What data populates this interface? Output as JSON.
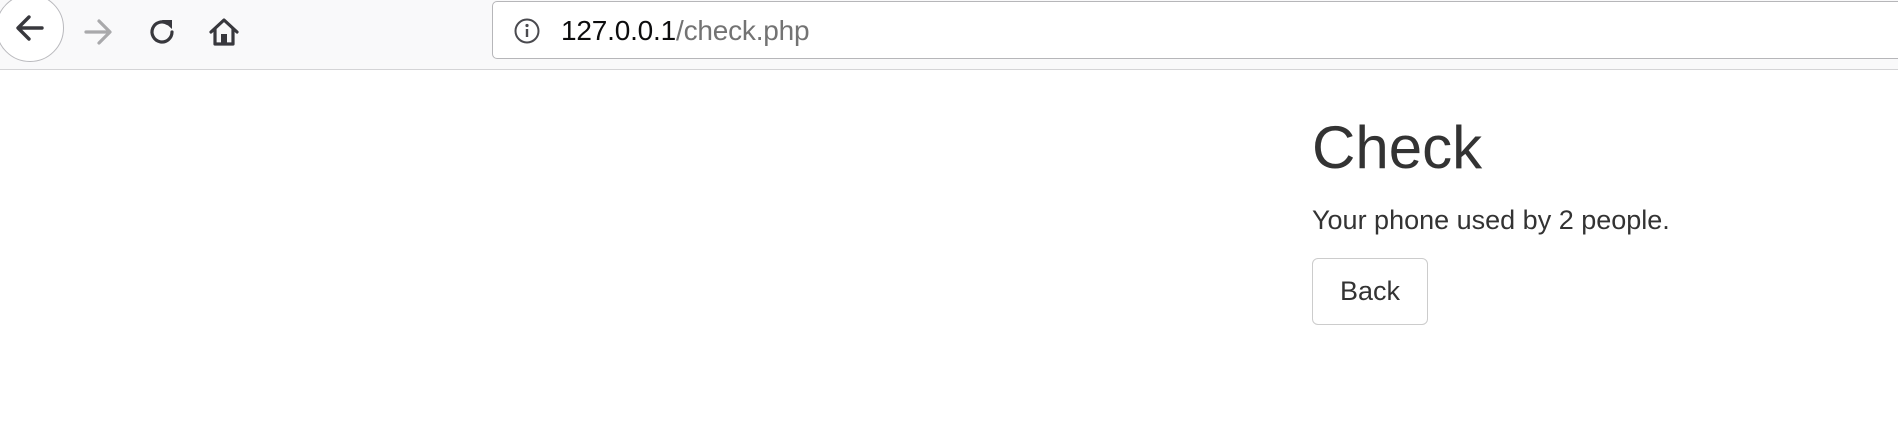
{
  "browser": {
    "url": {
      "host": "127.0.0.1",
      "path": "/check.php"
    },
    "icons": {
      "back": "back-arrow-icon",
      "forward": "forward-arrow-icon",
      "reload": "reload-icon",
      "home": "home-icon",
      "site_info": "info-icon"
    }
  },
  "page": {
    "title": "Check",
    "message": "Your phone used by 2 people.",
    "back_button_label": "Back"
  },
  "colors": {
    "text": "#333333",
    "url_path": "#737373",
    "toolbar_bg": "#f9f9fa"
  }
}
